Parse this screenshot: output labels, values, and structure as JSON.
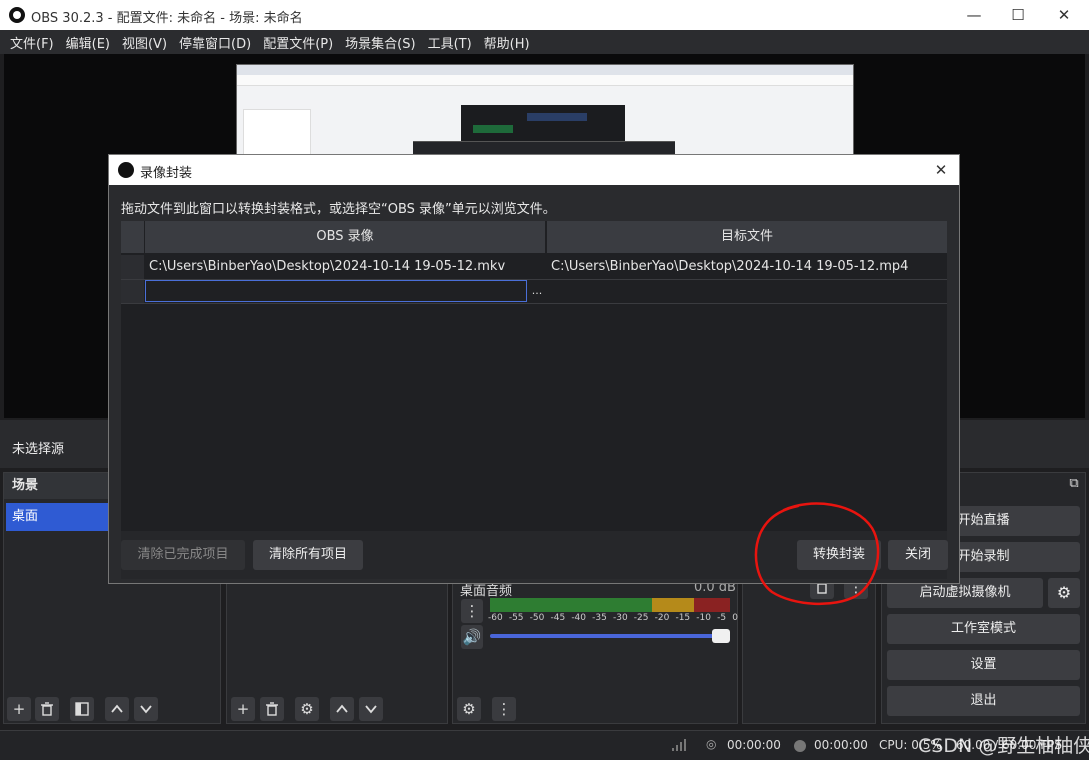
{
  "window": {
    "title": "OBS 30.2.3 - 配置文件: 未命名 - 场景: 未命名",
    "minimize": "—",
    "maximize": "☐",
    "close": "✕"
  },
  "menu": [
    "文件(F)",
    "编辑(E)",
    "视图(V)",
    "停靠窗口(D)",
    "配置文件(P)",
    "场景集合(S)",
    "工具(T)",
    "帮助(H)"
  ],
  "source_bar": {
    "label": "未选择源"
  },
  "scenes": {
    "title": "场景",
    "items": [
      "桌面"
    ]
  },
  "mixer": {
    "channel": "桌面音频",
    "level": "0.0 dB",
    "scale": [
      "-60",
      "-55",
      "-50",
      "-45",
      "-40",
      "-35",
      "-30",
      "-25",
      "-20",
      "-15",
      "-10",
      "-5",
      "0"
    ]
  },
  "controls": {
    "buttons": [
      "开始直播",
      "开始录制",
      "启动虚拟摄像机",
      "工作室模式",
      "设置",
      "退出"
    ]
  },
  "status": {
    "stream_time": "00:00:00",
    "rec_time": "00:00:00",
    "cpu": "CPU: 0.5%",
    "fps": "60.00 / 60.00 FPS"
  },
  "watermark": "CSDN @野生柚柚侠",
  "dialog": {
    "title": "录像封装",
    "close": "✕",
    "instructions": "拖动文件到此窗口以转换封装格式，或选择空“OBS 录像”单元以浏览文件。",
    "columns": [
      "OBS 录像",
      "目标文件"
    ],
    "rows": [
      {
        "source": "C:\\Users\\BinberYao\\Desktop\\2024-10-14 19-05-12.mkv",
        "target": "C:\\Users\\BinberYao\\Desktop\\2024-10-14 19-05-12.mp4"
      }
    ],
    "browse": "...",
    "buttons": {
      "clear_done": "清除已完成项目",
      "clear_all": "清除所有项目",
      "remux": "转换封装",
      "close": "关闭"
    }
  },
  "colors": {
    "accent_blue": "#2f5bd3",
    "annotation_red": "#e8140f",
    "meter_green": "#2e7d32",
    "meter_yellow": "#b58a1a",
    "meter_red": "#8a2222"
  }
}
